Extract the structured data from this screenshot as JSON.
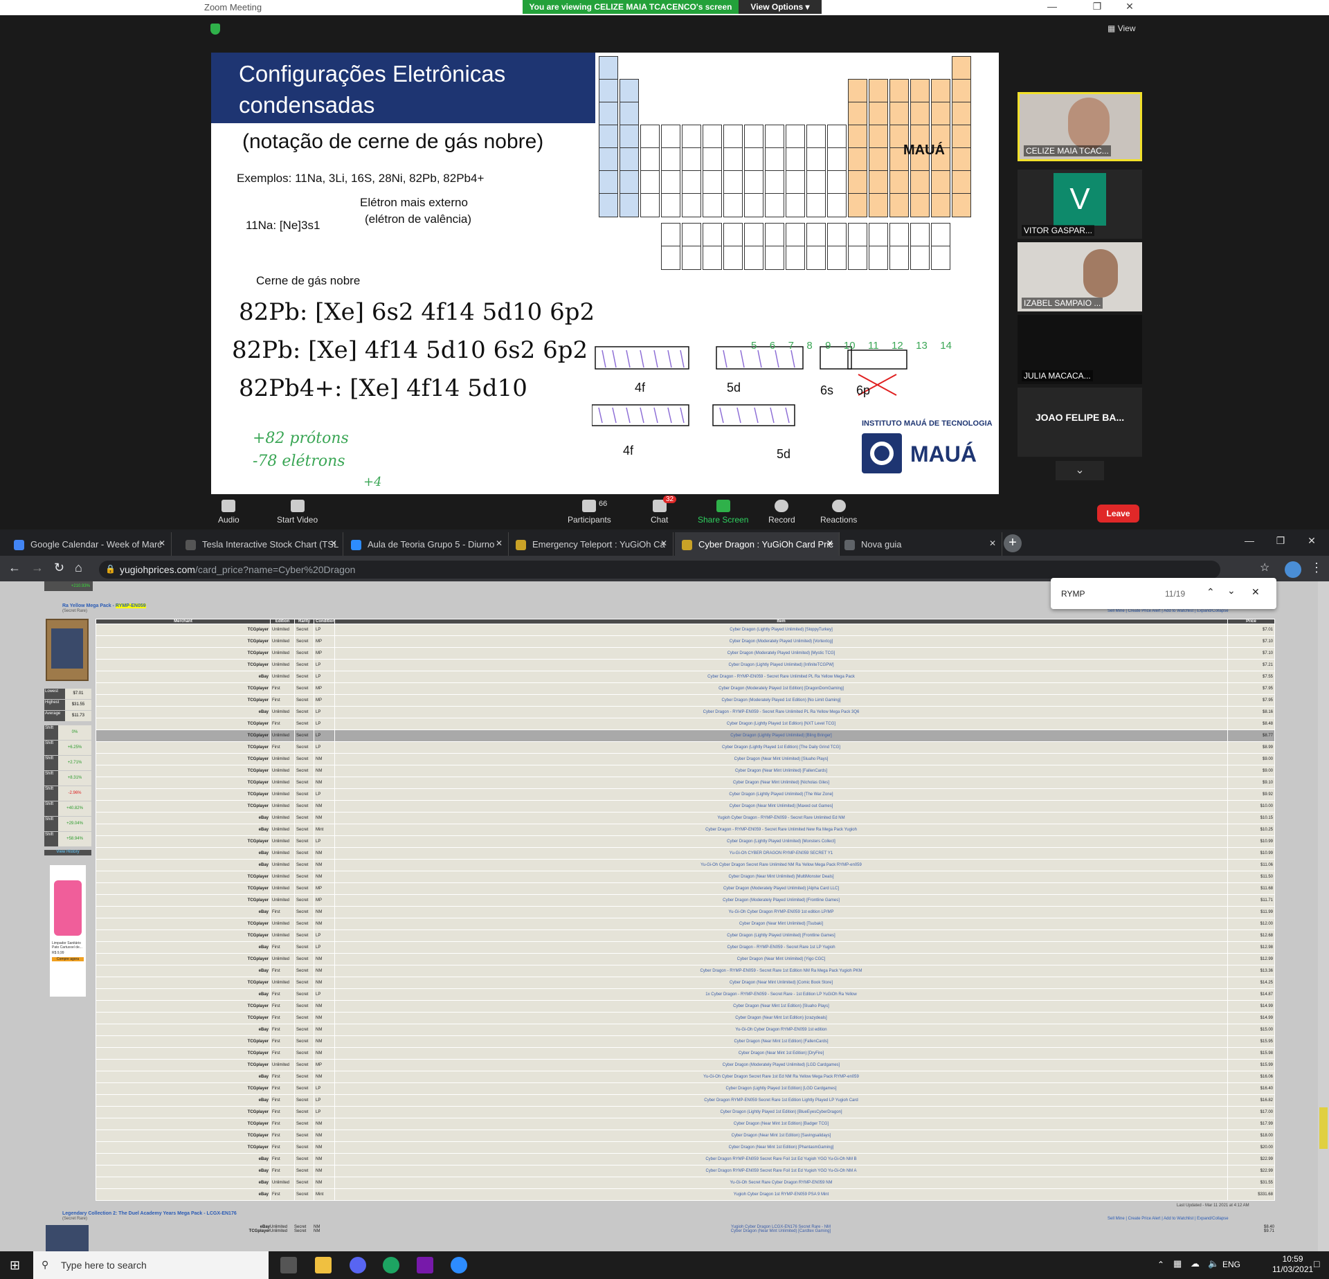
{
  "zoom": {
    "window_title": "Zoom Meeting",
    "viewing_banner": "You are viewing CELIZE MAIA TCACENCO's screen",
    "view_options": "View Options",
    "view_label": "View",
    "toolbar": {
      "audio": "Audio",
      "start_video": "Start Video",
      "participants": "Participants",
      "participants_count": "66",
      "chat": "Chat",
      "chat_badge": "32",
      "share_screen": "Share Screen",
      "record": "Record",
      "reactions": "Reactions",
      "leave": "Leave"
    },
    "participants": [
      {
        "name": "CELIZE MAIA TCAC..."
      },
      {
        "name": "VITOR GASPAR...",
        "initial": "V"
      },
      {
        "name": "IZABEL SAMPAIO ..."
      },
      {
        "name": "JULIA MACACA..."
      },
      {
        "name": "JOAO FELIPE BA..."
      }
    ]
  },
  "slide": {
    "title": "Configurações Eletrônicas condensadas",
    "subtitle": "(notação de cerne de gás nobre)",
    "examples": "Exemplos: 11Na, 3Li, 16S, 28Ni, 82Pb, 82Pb4+",
    "na_config": "11Na: [Ne]3s1",
    "outer_electron": "Elétron mais externo",
    "valence": "(elétron de valência)",
    "core": "Cerne de gás nobre",
    "hw1": "82Pb: [Xe] 6s2 4f14 5d10 6p2",
    "hw2": "82Pb: [Xe] 4f14 5d10 6s2 6p2",
    "hw3": "82Pb4+: [Xe] 4f14 5d10",
    "hw4": "+82 prótons",
    "hw5": "-78 elétrons",
    "hw6": "+4",
    "label_4f": "4f",
    "label_5d": "5d",
    "label_6s": "6s",
    "label_6p": "6p",
    "mauá": "MAUÁ",
    "instituto": "INSTITUTO MAUÁ DE TECNOLOGIA",
    "group_nums": [
      "5",
      "6",
      "7",
      "8",
      "9",
      "10",
      "11",
      "12",
      "13",
      "14"
    ]
  },
  "browser": {
    "tabs": [
      {
        "title": "Google Calendar - Week of Marc",
        "color": "#4285f4"
      },
      {
        "title": "Tesla Interactive Stock Chart (TSL",
        "color": "#555"
      },
      {
        "title": "Aula de Teoria Grupo 5 - Diurno",
        "color": "#2d8cff"
      },
      {
        "title": "Emergency Teleport : YuGiOh Ca",
        "color": "#c9a227"
      },
      {
        "title": "Cyber Dragon : YuGiOh Card Pric",
        "color": "#c9a227"
      },
      {
        "title": "Nova guia",
        "color": "#5f6368"
      }
    ],
    "url_host": "yugiohprices.com",
    "url_path": "/card_price?name=Cyber%20Dragon",
    "find_query": "RYMP",
    "find_count": "11/19"
  },
  "listing": {
    "set_name": "Ra Yellow Mega Pack",
    "set_code": "RYMP-EN059",
    "rarity": "(Secret Rare)",
    "links": "Sell Mine | Create Price Alert | Add to Watchlist | Expand/Collapse",
    "headers": [
      "Merchant",
      "Edition",
      "Rarity",
      "Condition",
      "Item",
      "Price"
    ],
    "stats": [
      {
        "label": "Lowest",
        "value": "$7.01"
      },
      {
        "label": "Highest",
        "value": "$31.55"
      },
      {
        "label": "Average",
        "value": "$11.73"
      }
    ],
    "shifts": [
      "0%",
      "+6.25%",
      "+2.71%",
      "+8.31%",
      "-2.96%",
      "+40.82%",
      "+29.04%",
      "+58.94%"
    ],
    "view_history": "View History",
    "last_updated": "Last Updated - Mar 11 2021 at 4:12 AM",
    "next_set": "Legendary Collection 2: The Duel Academy Years Mega Pack",
    "next_code": "LCGX-EN176",
    "rows": [
      [
        "TCGplayer",
        "Unlimited",
        "Secret",
        "LP",
        "Cyber Dragon (Lightly Played Unlimited) [SloppyTurkey]",
        "$7.01"
      ],
      [
        "TCGplayer",
        "Unlimited",
        "Secret",
        "MP",
        "Cyber Dragon (Moderately Played Unlimited) [Vortextcg]",
        "$7.10"
      ],
      [
        "TCGplayer",
        "Unlimited",
        "Secret",
        "MP",
        "Cyber Dragon (Moderately Played Unlimited) [Mystic TCG]",
        "$7.10"
      ],
      [
        "TCGplayer",
        "Unlimited",
        "Secret",
        "LP",
        "Cyber Dragon (Lightly Played Unlimited) [InfiniteTCGPW]",
        "$7.21"
      ],
      [
        "eBay",
        "Unlimited",
        "Secret",
        "LP",
        "Cyber Dragon - RYMP-EN059 - Secret Rare Unlimited PL Ra Yellow Mega Pack",
        "$7.55"
      ],
      [
        "TCGplayer",
        "First",
        "Secret",
        "MP",
        "Cyber Dragon (Moderately Played 1st Edition) [DragonDomGaming]",
        "$7.95"
      ],
      [
        "TCGplayer",
        "First",
        "Secret",
        "MP",
        "Cyber Dragon (Moderately Played 1st Edition) [No Limit Gaming]",
        "$7.95"
      ],
      [
        "eBay",
        "Unlimited",
        "Secret",
        "LP",
        "Cyber Dragon - RYMP-EN059 - Secret Rare Unlimited PL Ra Yellow Mega Pack 3Q6",
        "$8.16"
      ],
      [
        "TCGplayer",
        "First",
        "Secret",
        "LP",
        "Cyber Dragon (Lightly Played 1st Edition) [NXT Level TCG]",
        "$8.48"
      ],
      [
        "TCGplayer",
        "Unlimited",
        "Secret",
        "LP",
        "Cyber Dragon (Lightly Played Unlimited) [Bling Bringer]",
        "$8.77"
      ],
      [
        "TCGplayer",
        "First",
        "Secret",
        "LP",
        "Cyber Dragon (Lightly Played 1st Edition) [The Daily Grind TCG]",
        "$8.99"
      ],
      [
        "TCGplayer",
        "Unlimited",
        "Secret",
        "NM",
        "Cyber Dragon (Near Mint Unlimited) [Sluaho Plays]",
        "$9.00"
      ],
      [
        "TCGplayer",
        "Unlimited",
        "Secret",
        "NM",
        "Cyber Dragon (Near Mint Unlimited) [FallenCards]",
        "$9.00"
      ],
      [
        "TCGplayer",
        "Unlimited",
        "Secret",
        "NM",
        "Cyber Dragon (Near Mint Unlimited) [Nicholas Giles]",
        "$9.10"
      ],
      [
        "TCGplayer",
        "Unlimited",
        "Secret",
        "LP",
        "Cyber Dragon (Lightly Played Unlimited) [The War Zone]",
        "$9.92"
      ],
      [
        "TCGplayer",
        "Unlimited",
        "Secret",
        "NM",
        "Cyber Dragon (Near Mint Unlimited) [Maxed out Games]",
        "$10.00"
      ],
      [
        "eBay",
        "Unlimited",
        "Secret",
        "NM",
        "Yugioh Cyber Dragon - RYMP-EN059 - Secret Rare Unlimited Ed NM",
        "$10.15"
      ],
      [
        "eBay",
        "Unlimited",
        "Secret",
        "Mint",
        "Cyber Dragon - RYMP-EN059 - Secret Rare Unlimited New Ra Mega Pack Yugioh",
        "$10.25"
      ],
      [
        "TCGplayer",
        "Unlimited",
        "Secret",
        "LP",
        "Cyber Dragon (Lightly Played Unlimited) [Monsters Collect]",
        "$10.99"
      ],
      [
        "eBay",
        "Unlimited",
        "Secret",
        "NM",
        "Yu-Gi-Oh CYBER DRAGON RYMP-EN059 SECRET Y1",
        "$10.99"
      ],
      [
        "eBay",
        "Unlimited",
        "Secret",
        "NM",
        "Yu-Gi-Oh Cyber Dragon Secret Rare Unlimited NM Ra Yellow Mega Pack RYMP-en059",
        "$11.06"
      ],
      [
        "TCGplayer",
        "Unlimited",
        "Secret",
        "NM",
        "Cyber Dragon (Near Mint Unlimited) [MultiMonster Deals]",
        "$11.50"
      ],
      [
        "TCGplayer",
        "Unlimited",
        "Secret",
        "MP",
        "Cyber Dragon (Moderately Played Unlimited) [Alpha Card LLC]",
        "$11.68"
      ],
      [
        "TCGplayer",
        "Unlimited",
        "Secret",
        "MP",
        "Cyber Dragon (Moderately Played Unlimited) [Frontline Games]",
        "$11.71"
      ],
      [
        "eBay",
        "First",
        "Secret",
        "NM",
        "Yu-Gi-Oh Cyber Dragon RYMP-EN059 1st edition LP/MP",
        "$11.99"
      ],
      [
        "TCGplayer",
        "Unlimited",
        "Secret",
        "NM",
        "Cyber Dragon (Near Mint Unlimited) [Tsubaki]",
        "$12.00"
      ],
      [
        "TCGplayer",
        "Unlimited",
        "Secret",
        "LP",
        "Cyber Dragon (Lightly Played Unlimited) [Frontline Games]",
        "$12.68"
      ],
      [
        "eBay",
        "First",
        "Secret",
        "LP",
        "Cyber Dragon - RYMP-EN059 - Secret Rare 1st LP Yugioh",
        "$12.98"
      ],
      [
        "TCGplayer",
        "Unlimited",
        "Secret",
        "NM",
        "Cyber Dragon (Near Mint Unlimited) [Yigo CGC]",
        "$12.99"
      ],
      [
        "eBay",
        "First",
        "Secret",
        "NM",
        "Cyber Dragon - RYMP-EN059 - Secret Rare 1st Edition NM Ra Mega Pack Yugioh PKM",
        "$13.36"
      ],
      [
        "TCGplayer",
        "Unlimited",
        "Secret",
        "NM",
        "Cyber Dragon (Near Mint Unlimited) [Comic Book Store]",
        "$14.25"
      ],
      [
        "eBay",
        "First",
        "Secret",
        "LP",
        "1x Cyber Dragon - RYMP-EN059 - Secret Rare - 1st Edition LP YuGiOh Ra Yellow",
        "$14.87"
      ],
      [
        "TCGplayer",
        "First",
        "Secret",
        "NM",
        "Cyber Dragon (Near Mint 1st Edition) [Sluaho Plays]",
        "$14.99"
      ],
      [
        "TCGplayer",
        "First",
        "Secret",
        "NM",
        "Cyber Dragon (Near Mint 1st Edition) [crazydeals]",
        "$14.99"
      ],
      [
        "eBay",
        "First",
        "Secret",
        "NM",
        "Yu-Gi-Oh Cyber Dragon RYMP-EN059 1st edition",
        "$15.00"
      ],
      [
        "TCGplayer",
        "First",
        "Secret",
        "NM",
        "Cyber Dragon (Near Mint 1st Edition) [FallenCards]",
        "$15.95"
      ],
      [
        "TCGplayer",
        "First",
        "Secret",
        "NM",
        "Cyber Dragon (Near Mint 1st Edition) [DryFire]",
        "$15.98"
      ],
      [
        "TCGplayer",
        "Unlimited",
        "Secret",
        "MP",
        "Cyber Dragon (Moderately Played Unlimited) [LGD Cardgames]",
        "$15.99"
      ],
      [
        "eBay",
        "First",
        "Secret",
        "NM",
        "Yu-Gi-Oh Cyber Dragon Secret Rare 1st Ed NM Ra Yellow Mega Pack RYMP-en059",
        "$16.06"
      ],
      [
        "TCGplayer",
        "First",
        "Secret",
        "LP",
        "Cyber Dragon (Lightly Played 1st Edition) [LGD Cardgames]",
        "$16.40"
      ],
      [
        "eBay",
        "First",
        "Secret",
        "LP",
        "Cyber Dragon RYMP-EN059 Secret Rare 1st Edition Lightly Played LP Yugioh Card",
        "$16.82"
      ],
      [
        "TCGplayer",
        "First",
        "Secret",
        "LP",
        "Cyber Dragon (Lightly Played 1st Edition) [BlueEyesCyberDragon]",
        "$17.00"
      ],
      [
        "TCGplayer",
        "First",
        "Secret",
        "NM",
        "Cyber Dragon (Near Mint 1st Edition) [Badger TCG]",
        "$17.99"
      ],
      [
        "TCGplayer",
        "First",
        "Secret",
        "NM",
        "Cyber Dragon (Near Mint 1st Edition) [Savingsalidays]",
        "$18.00"
      ],
      [
        "TCGplayer",
        "First",
        "Secret",
        "NM",
        "Cyber Dragon (Near Mint 1st Edition) [PhantasmGaming]",
        "$20.00"
      ],
      [
        "eBay",
        "First",
        "Secret",
        "NM",
        "Cyber Dragon RYMP-EN059 Secret Rare Foil 1st Ed Yugioh YGO Yu-Gi-Oh NM B",
        "$22.99"
      ],
      [
        "eBay",
        "First",
        "Secret",
        "NM",
        "Cyber Dragon RYMP-EN059 Secret Rare Foil 1st Ed Yugioh YGO Yu-Gi-Oh NM A",
        "$22.99"
      ],
      [
        "eBay",
        "Unlimited",
        "Secret",
        "NM",
        "Yu-Gi-Oh Secret Rare Cyber Dragon RYMP-EN059 NM",
        "$31.55"
      ],
      [
        "eBay",
        "First",
        "Secret",
        "Mint",
        "Yugioh Cyber Dragon 1st RYMP-EN059 PSA 9 Mint",
        "$331.68"
      ]
    ],
    "next_rows": [
      [
        "eBay",
        "Unlimited",
        "Secret",
        "NM",
        "Yugioh Cyber Dragon LCGX-EN176 Secret Rare - NM",
        "$8.40"
      ],
      [
        "TCGplayer",
        "Unlimited",
        "Secret",
        "NM",
        "Cyber Dragon (Near Mint Unlimited) [Cardtex Gaming]",
        "$9.71"
      ]
    ],
    "ad_text": "Limpador Sanitário Pato Cartuxxel de...",
    "ad_price": "R$ 9,99",
    "ad_button": "Compre agora"
  },
  "taskbar": {
    "search_placeholder": "Type here to search",
    "lang": "ENG",
    "time": "10:59",
    "date": "11/03/2021"
  }
}
